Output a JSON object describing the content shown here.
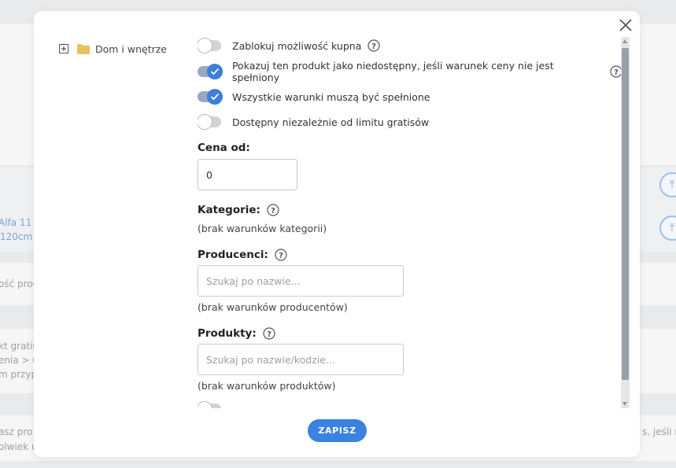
{
  "background": {
    "fragments": [
      "Alfa 11 -",
      "120cm",
      "ość prod",
      "kt gratis",
      "enia > C",
      "m przyp",
      "asz pro",
      "olwiek u",
      "s, jeśli n"
    ]
  },
  "tree": {
    "label": "Dom i wnętrze"
  },
  "toggles": [
    {
      "label": "Zablokuj możliwość kupna",
      "checked": false,
      "help": true
    },
    {
      "label": "Pokazuj ten produkt jako niedostępny, jeśli warunek ceny nie jest spełniony",
      "checked": true,
      "help": true
    },
    {
      "label": "Wszystkie warunki muszą być spełnione",
      "checked": true,
      "help": false
    },
    {
      "label": "Dostępny niezależnie od limitu gratisów",
      "checked": false,
      "help": false
    }
  ],
  "price": {
    "label": "Cena od:",
    "value": "0"
  },
  "categories": {
    "label": "Kategorie:",
    "empty": "(brak warunków kategorii)"
  },
  "producers": {
    "label": "Producenci:",
    "placeholder": "Szukaj po nazwie...",
    "empty": "(brak warunków producentów)"
  },
  "products": {
    "label": "Produkty:",
    "placeholder": "Szukaj po nazwie/kodzie...",
    "empty": "(brak warunków produktów)"
  },
  "save_label": "ZAPISZ",
  "colors": {
    "accent": "#3b82e0",
    "toggle_on": "#3b7fd9"
  }
}
